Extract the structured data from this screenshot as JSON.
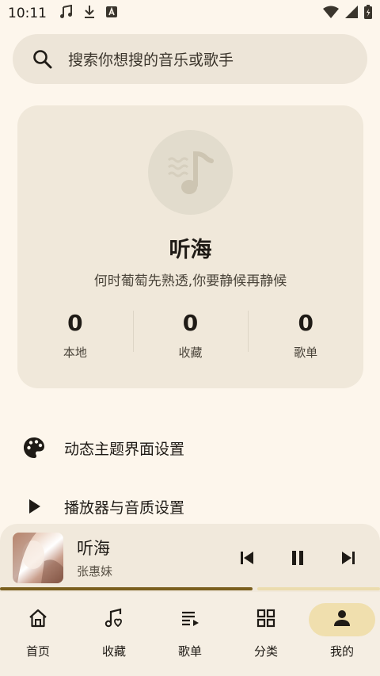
{
  "status_bar": {
    "time": "10:11",
    "left_icons": [
      "music-note-icon",
      "download-icon",
      "a-badge-icon"
    ],
    "right_icons": [
      "wifi-icon",
      "signal-icon",
      "battery-icon"
    ]
  },
  "search": {
    "placeholder": "搜索你想搜的音乐或歌手"
  },
  "profile": {
    "name": "听海",
    "bio": "何时葡萄先熟透,你要静候再静候",
    "stats": [
      {
        "value": "0",
        "label": "本地"
      },
      {
        "value": "0",
        "label": "收藏"
      },
      {
        "value": "0",
        "label": "歌单"
      }
    ]
  },
  "menu": [
    {
      "icon": "palette-icon",
      "label": "动态主题界面设置"
    },
    {
      "icon": "play-icon",
      "label": "播放器与音质设置"
    }
  ],
  "player": {
    "title": "听海",
    "artist": "张惠妹",
    "progress": 0.665
  },
  "nav": [
    {
      "icon": "home-icon",
      "label": "首页"
    },
    {
      "icon": "favorite-music-icon",
      "label": "收藏"
    },
    {
      "icon": "playlist-icon",
      "label": "歌单"
    },
    {
      "icon": "category-icon",
      "label": "分类"
    },
    {
      "icon": "person-icon",
      "label": "我的",
      "active": true
    }
  ],
  "colors": {
    "background": "#fdf6ec",
    "accent": "#7a5f1e",
    "active_nav": "#f0dfae"
  }
}
